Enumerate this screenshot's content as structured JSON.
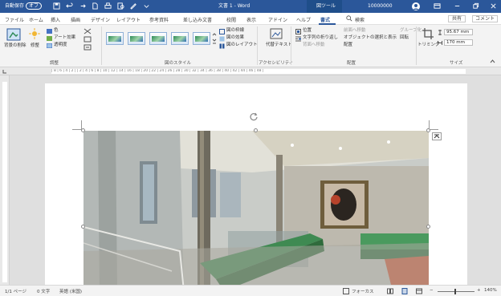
{
  "titlebar": {
    "autosave": "自動保存",
    "autosave_toggle": "オフ",
    "doc_title": "文書 1 - Word",
    "context_tool": "図ツール",
    "user": "10000000",
    "colors": {
      "bar": "#2b579a",
      "context": "#1f4e8a"
    }
  },
  "tabs": [
    "ファイル",
    "ホーム",
    "挿入",
    "描画",
    "デザイン",
    "レイアウト",
    "参考資料",
    "差し込み文書",
    "校閲",
    "表示",
    "アドイン",
    "ヘルプ",
    "書式",
    "検索"
  ],
  "tab_actions": {
    "share": "共有",
    "comments": "コメント"
  },
  "ribbon": {
    "adjust": {
      "remove_bg": "背景の削除",
      "corrections": "修整",
      "color": "色",
      "art_effects": "アート効果",
      "transparency": "透明度",
      "group": "調整"
    },
    "styles": {
      "group": "図のスタイル"
    },
    "style_options": {
      "border": "図の枠線",
      "effects": "図の効果",
      "layout": "図のレイアウト"
    },
    "accessibility": {
      "alt_text": "代替テキスト",
      "group": "アクセシビリティ"
    },
    "arrange": {
      "position": "位置",
      "wrap_text": "文字列の折り返し",
      "bring_forward": "前面へ移動",
      "send_backward": "背面へ移動",
      "selection_pane": "オブジェクトの選択と表示",
      "align": "配置",
      "group_objects": "グループ化",
      "rotate": "回転",
      "group": "配置"
    },
    "size": {
      "crop": "トリミング",
      "height": "95.67 mm",
      "width": "170 mm",
      "group": "サイズ"
    }
  },
  "ruler": {
    "marks": "| 8 | 6 | 4 | 2 | | 2 | 4 | 6 | 8 | 10 | 12 | 14 | 16 | 18 | 20 | 22 | 24 | 26 | 28 | 30 | 32 | 34 | 36 | 38 | 40 | 42 | 44 | 46 | 48 |"
  },
  "statusbar": {
    "page": "1/1 ページ",
    "words": "0 文字",
    "language": "英語 (米国)",
    "focus": "フォーカス",
    "zoom": "140%"
  }
}
